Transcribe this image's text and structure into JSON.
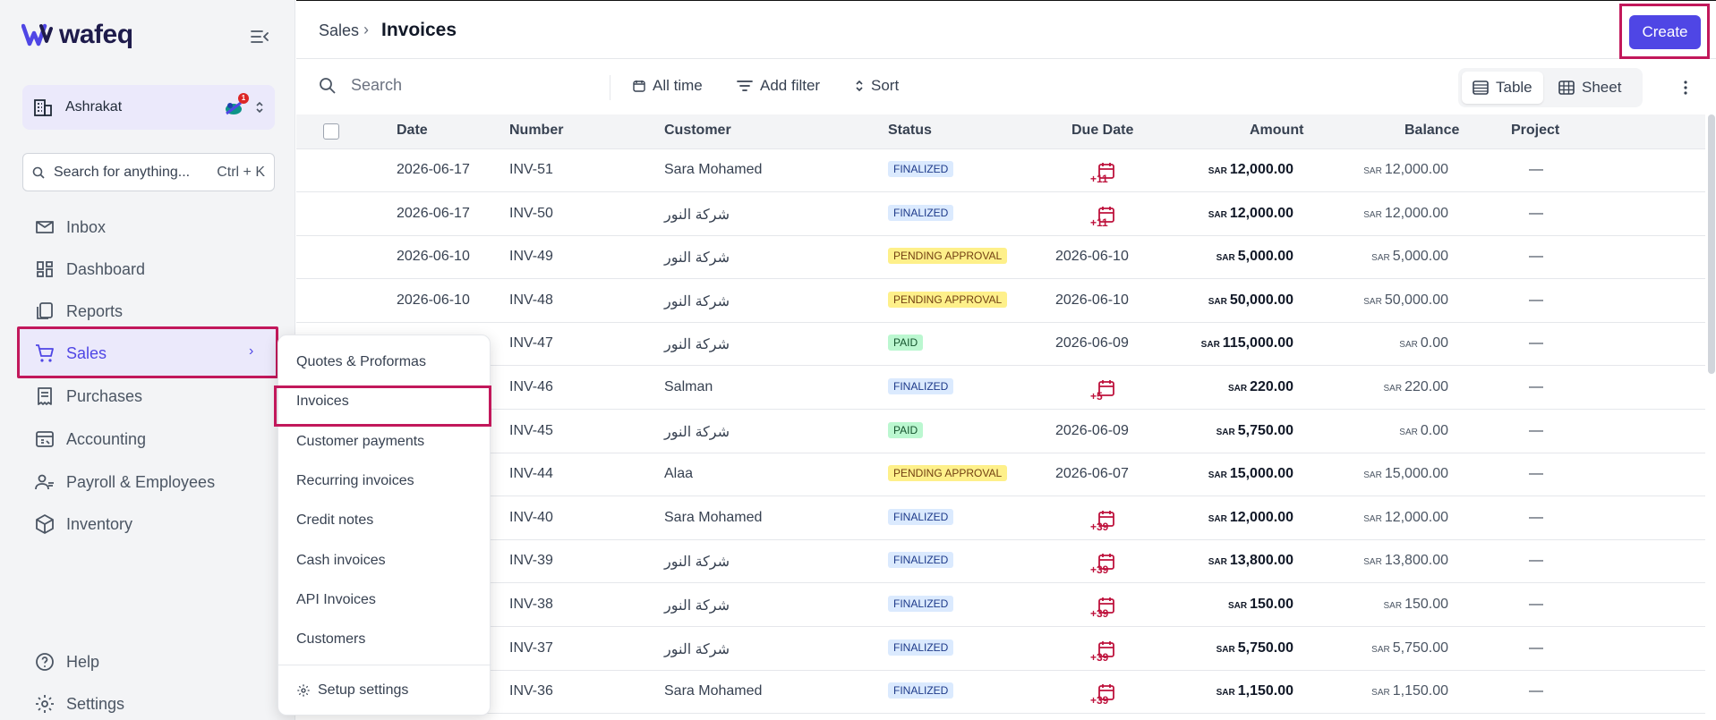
{
  "brand": {
    "name": "wafeq"
  },
  "org": {
    "name": "Ashrakat",
    "badge": "1"
  },
  "search": {
    "placeholder": "Search for anything...",
    "shortcut": "Ctrl + K"
  },
  "nav": {
    "inbox": "Inbox",
    "dashboard": "Dashboard",
    "reports": "Reports",
    "sales": "Sales",
    "purchases": "Purchases",
    "accounting": "Accounting",
    "payroll": "Payroll & Employees",
    "inventory": "Inventory",
    "help": "Help",
    "settings": "Settings"
  },
  "submenu": {
    "items": [
      "Quotes & Proformas",
      "Invoices",
      "Customer payments",
      "Recurring invoices",
      "Credit notes",
      "Cash invoices",
      "API Invoices",
      "Customers"
    ],
    "setup": "Setup settings"
  },
  "breadcrumb": {
    "parent": "Sales",
    "separator": "›",
    "current": "Invoices"
  },
  "actions": {
    "create": "Create"
  },
  "toolbar": {
    "search_placeholder": "Search",
    "all_time": "All time",
    "add_filter": "Add filter",
    "sort": "Sort",
    "view_table": "Table",
    "view_sheet": "Sheet"
  },
  "table": {
    "headers": {
      "date": "Date",
      "number": "Number",
      "customer": "Customer",
      "status": "Status",
      "due_date": "Due Date",
      "amount": "Amount",
      "balance": "Balance",
      "project": "Project"
    },
    "currency": "SAR",
    "rows": [
      {
        "date": "2026-06-17",
        "number": "INV-51",
        "customer": "Sara Mohamed",
        "status": "FINALIZED",
        "status_type": "finalized",
        "due": "",
        "due_overdue": "+11",
        "amount": "12,000.00",
        "balance": "12,000.00",
        "project": "—"
      },
      {
        "date": "2026-06-17",
        "number": "INV-50",
        "customer": "شركة النور",
        "status": "FINALIZED",
        "status_type": "finalized",
        "due": "",
        "due_overdue": "+11",
        "amount": "12,000.00",
        "balance": "12,000.00",
        "project": "—"
      },
      {
        "date": "2026-06-10",
        "number": "INV-49",
        "customer": "شركة النور",
        "status": "PENDING APPROVAL",
        "status_type": "pending",
        "due": "2026-06-10",
        "due_overdue": "",
        "amount": "5,000.00",
        "balance": "5,000.00",
        "project": "—"
      },
      {
        "date": "2026-06-10",
        "number": "INV-48",
        "customer": "شركة النور",
        "status": "PENDING APPROVAL",
        "status_type": "pending",
        "due": "2026-06-10",
        "due_overdue": "",
        "amount": "50,000.00",
        "balance": "50,000.00",
        "project": "—"
      },
      {
        "date": "",
        "number": "INV-47",
        "customer": "شركة النور",
        "status": "PAID",
        "status_type": "paid",
        "due": "2026-06-09",
        "due_overdue": "",
        "amount": "115,000.00",
        "balance": "0.00",
        "project": "—"
      },
      {
        "date": "",
        "number": "INV-46",
        "customer": "Salman",
        "status": "FINALIZED",
        "status_type": "finalized",
        "due": "",
        "due_overdue": "+5",
        "amount": "220.00",
        "balance": "220.00",
        "project": "—"
      },
      {
        "date": "",
        "number": "INV-45",
        "customer": "شركة النور",
        "status": "PAID",
        "status_type": "paid",
        "due": "2026-06-09",
        "due_overdue": "",
        "amount": "5,750.00",
        "balance": "0.00",
        "project": "—"
      },
      {
        "date": "",
        "number": "INV-44",
        "customer": "Alaa",
        "status": "PENDING APPROVAL",
        "status_type": "pending",
        "due": "2026-06-07",
        "due_overdue": "",
        "amount": "15,000.00",
        "balance": "15,000.00",
        "project": "—"
      },
      {
        "date": "",
        "number": "INV-40",
        "customer": "Sara Mohamed",
        "status": "FINALIZED",
        "status_type": "finalized",
        "due": "",
        "due_overdue": "+39",
        "amount": "12,000.00",
        "balance": "12,000.00",
        "project": "—"
      },
      {
        "date": "",
        "number": "INV-39",
        "customer": "شركة النور",
        "status": "FINALIZED",
        "status_type": "finalized",
        "due": "",
        "due_overdue": "+39",
        "amount": "13,800.00",
        "balance": "13,800.00",
        "project": "—"
      },
      {
        "date": "",
        "number": "INV-38",
        "customer": "شركة النور",
        "status": "FINALIZED",
        "status_type": "finalized",
        "due": "",
        "due_overdue": "+39",
        "amount": "150.00",
        "balance": "150.00",
        "project": "—"
      },
      {
        "date": "",
        "number": "INV-37",
        "customer": "شركة النور",
        "status": "FINALIZED",
        "status_type": "finalized",
        "due": "",
        "due_overdue": "+39",
        "amount": "5,750.00",
        "balance": "5,750.00",
        "project": "—"
      },
      {
        "date": "",
        "number": "INV-36",
        "customer": "Sara Mohamed",
        "status": "FINALIZED",
        "status_type": "finalized",
        "due": "",
        "due_overdue": "+39",
        "amount": "1,150.00",
        "balance": "1,150.00",
        "project": "—"
      }
    ]
  },
  "colors": {
    "accent": "#4f46e5",
    "highlight": "#c2185b",
    "overdue": "#be123c"
  }
}
